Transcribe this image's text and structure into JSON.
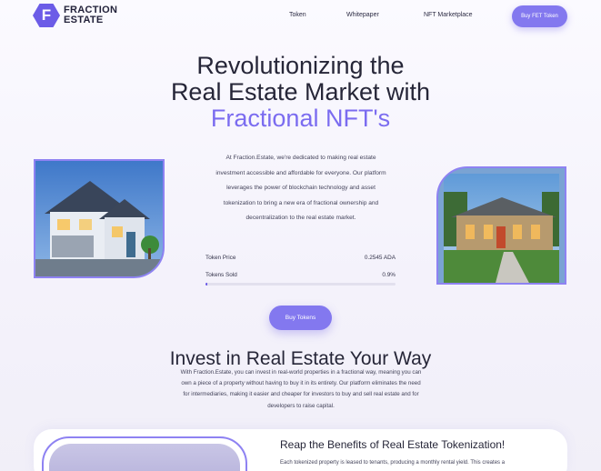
{
  "header": {
    "logo_line1": "FRACTION",
    "logo_line2": "ESTATE",
    "logo_mark": "F",
    "nav": {
      "token": "Token",
      "whitepaper": "Whitepaper",
      "nft_marketplace": "NFT Marketplace"
    },
    "cta_label": "Buy FET Token"
  },
  "hero": {
    "headline_line1": "Revolutionizing the",
    "headline_line2": "Real Estate Market with",
    "headline_line3": "Fractional NFT's",
    "description_lines": [
      "At Fraction.Estate, we're dedicated to making real estate",
      "investment accessible and affordable for everyone. Our platform",
      "leverages the power of blockchain technology and asset",
      "tokenization to bring a new era of fractional ownership and",
      "decentralization to the real estate market."
    ],
    "stats": {
      "token_price_label": "Token Price",
      "token_price_value": "0.2545 ADA",
      "tokens_sold_label": "Tokens Sold",
      "tokens_sold_value": "0.9%",
      "tokens_sold_fraction": 0.009
    },
    "buy_tokens_label": "Buy Tokens"
  },
  "invest": {
    "title": "Invest in Real Estate Your Way",
    "body_lines": [
      "With Fraction.Estate, you can invest in real-world properties in a fractional way, meaning you can",
      "own a piece of a property without having to buy it in its entirety. Our platform eliminates the need",
      "for intermediaries, making it easier and cheaper for investors to buy and sell real estate and for",
      "developers to raise capital."
    ]
  },
  "benefits": {
    "title": "Reap the Benefits of Real Estate Tokenization!",
    "body": "Each tokenized property is leased to tenants, producing a monthly rental yield. This creates a"
  },
  "colors": {
    "accent": "#7b6cf0",
    "button": "#8378ef",
    "text": "#262638"
  }
}
